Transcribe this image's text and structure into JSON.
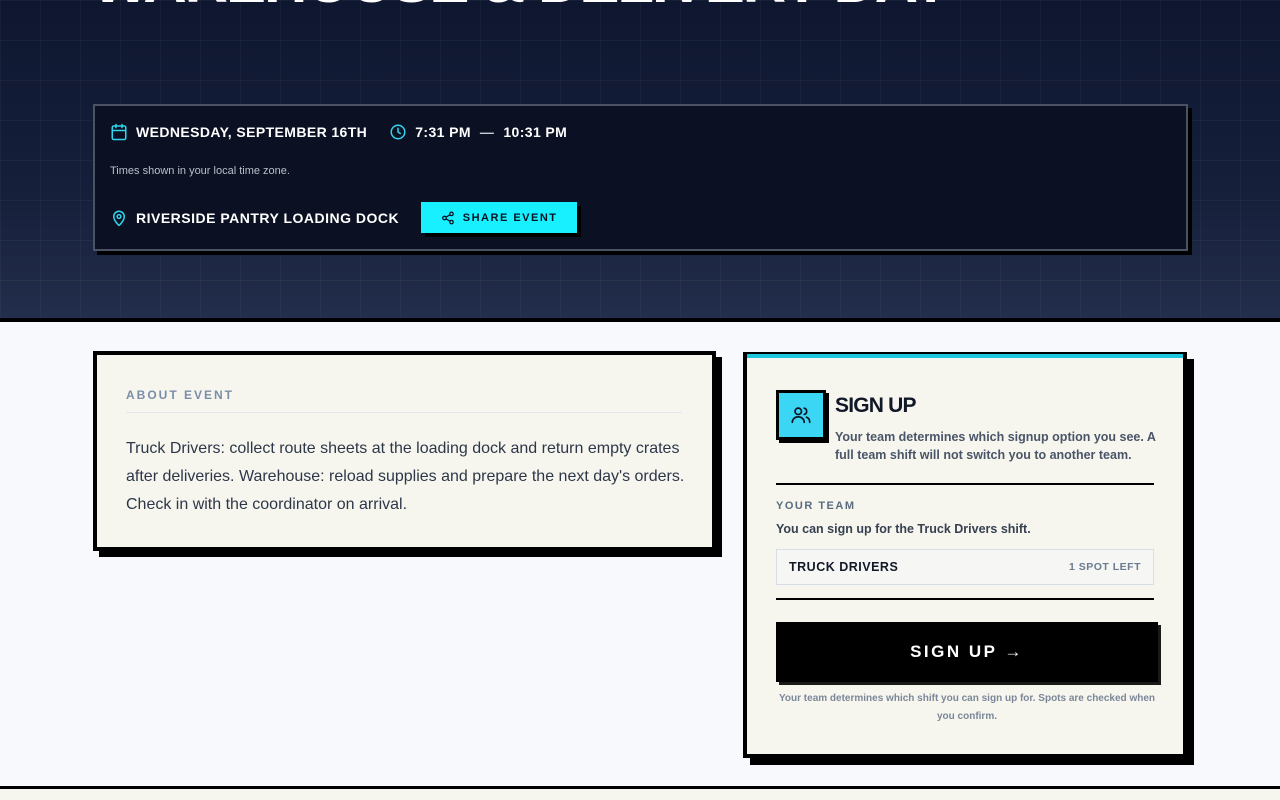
{
  "hero": {
    "title": "Warehouse & Delivery Day",
    "date": "WEDNESDAY, SEPTEMBER 16TH",
    "time_start": "7:31 PM",
    "time_separator": "—",
    "time_end": "10:31 PM",
    "timezone_note": "Times shown in your local time zone.",
    "location": "RIVERSIDE PANTRY LOADING DOCK",
    "share_label": "SHARE EVENT",
    "accent_color": "#19f0ff"
  },
  "about": {
    "heading": "ABOUT EVENT",
    "body": "Truck Drivers: collect route sheets at the loading dock and return empty crates after deliveries. Warehouse: reload supplies and prepare the next day's orders. Check in with the coordinator on arrival."
  },
  "signup": {
    "title": "SIGN UP",
    "description": "Your team determines which signup option you see. A full team shift will not switch you to another team.",
    "team_label": "YOUR TEAM",
    "team_note": "You can sign up for the Truck Drivers shift.",
    "shift_name": "TRUCK DRIVERS",
    "shift_spots": "1 SPOT LEFT",
    "button_label": "SIGN UP →",
    "footnote": "Your team determines which shift you can sign up for. Spots are checked when you confirm.",
    "accent_color": "#1fc7dd"
  },
  "icons": {
    "date": "calendar-icon",
    "time": "clock-icon",
    "location": "map-pin-icon",
    "share": "share-icon",
    "signup": "users-icon"
  }
}
